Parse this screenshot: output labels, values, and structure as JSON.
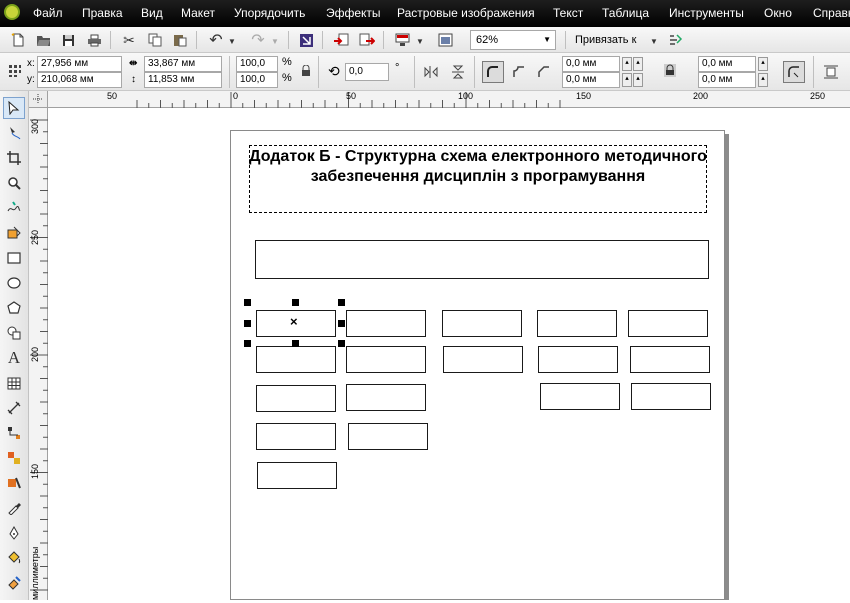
{
  "menu": [
    "Файл",
    "Правка",
    "Вид",
    "Макет",
    "Упорядочить",
    "Эффекты",
    "Растровые изображения",
    "Текст",
    "Таблица",
    "Инструменты",
    "Окно",
    "Справка"
  ],
  "toolbar": {
    "zoom": "62%",
    "snap_label": "Привязать к"
  },
  "property_bar": {
    "x_label": "x:",
    "x_value": "27,956 мм",
    "y_label": "y:",
    "y_value": "210,068 мм",
    "width_value": "33,867 мм",
    "height_value": "11,853 мм",
    "scale_x": "100,0",
    "scale_y": "100,0",
    "percent": "%",
    "rotation": "0,0",
    "degree": "°",
    "corner_tl": "0,0 мм",
    "corner_bl": "0,0 мм",
    "corner_tr": "0,0 мм",
    "corner_br": "0,0 мм"
  },
  "ruler_top": [
    "50",
    "0",
    "50",
    "100",
    "150",
    "200",
    "250"
  ],
  "ruler_left": [
    "300",
    "250",
    "200",
    "150"
  ],
  "ruler_left_unit": "миллиметры",
  "document": {
    "title": "Додаток Б - Структурна схема електронного методичного забезпечення дисциплін з програмування"
  },
  "center_marker": "×"
}
